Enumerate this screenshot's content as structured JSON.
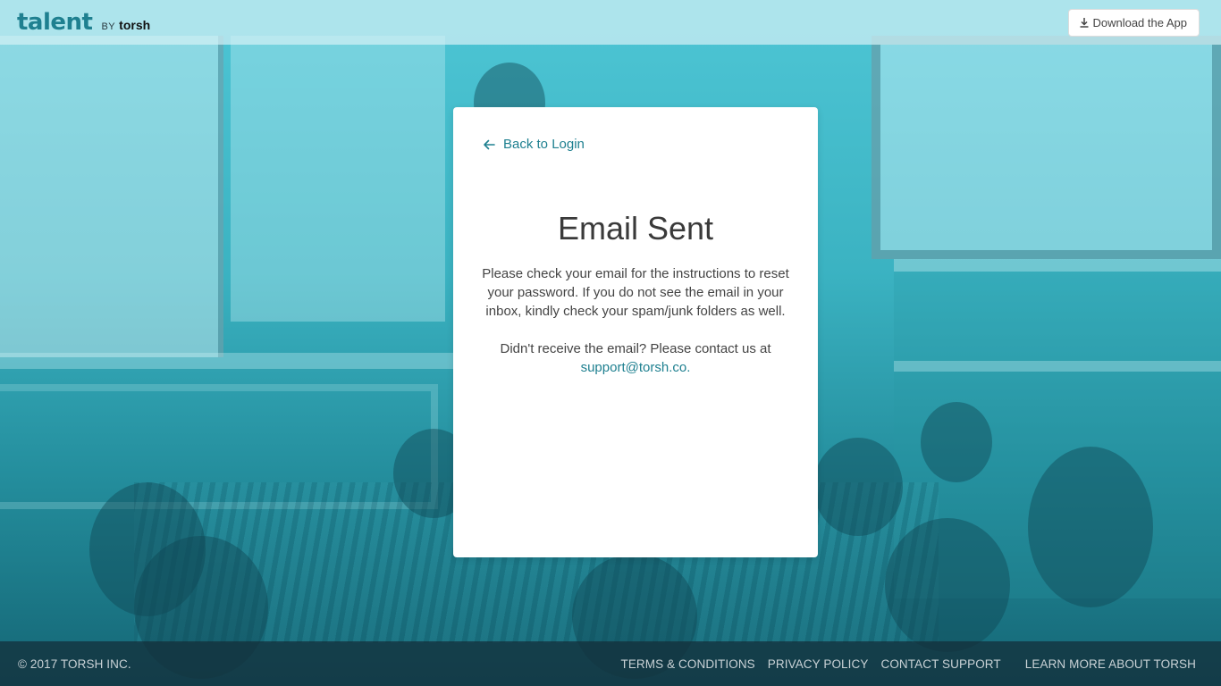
{
  "header": {
    "logo_talent": "talent",
    "logo_by": "BY",
    "logo_torsh": "torsh",
    "download_label": "Download the App"
  },
  "card": {
    "back_label": "Back to Login",
    "title": "Email Sent",
    "message": "Please check your email for the instructions to reset your password. If you do not see the email in your inbox, kindly check your spam/junk folders as well.",
    "contact_text": "Didn't receive the email? Please contact us at",
    "support_email": "support@torsh.co."
  },
  "footer": {
    "copyright": "© 2017 TORSH INC.",
    "links": [
      "TERMS & CONDITIONS",
      "PRIVACY POLICY",
      "CONTACT SUPPORT",
      "LEARN MORE ABOUT TORSH"
    ]
  },
  "colors": {
    "accent": "#1f8090",
    "overlay": "#3fb4c4",
    "footer_bg": "#142d37"
  },
  "icons": {
    "download": "download-icon",
    "back": "arrow-left-icon"
  }
}
